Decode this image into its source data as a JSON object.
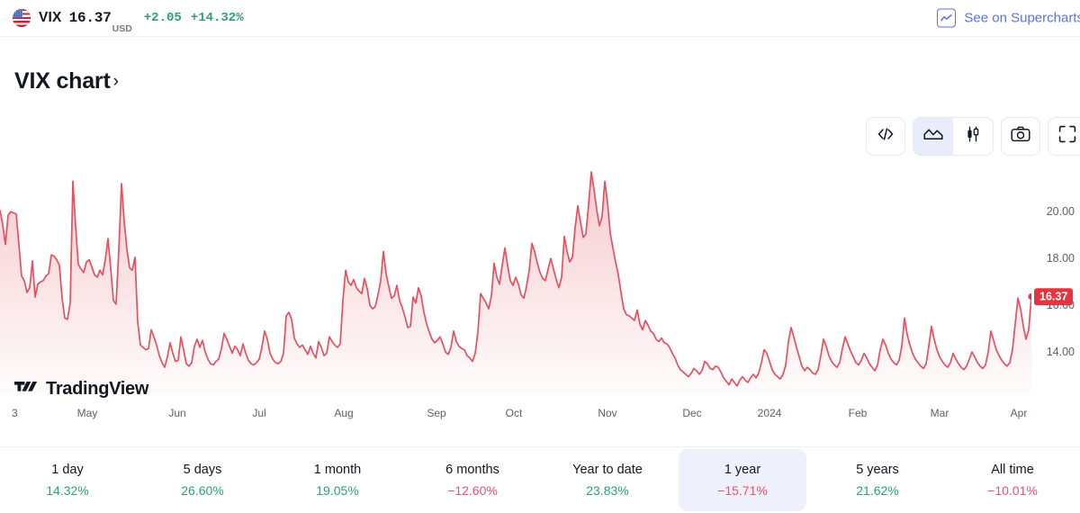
{
  "quote": {
    "flag_icon": "us-flag-icon",
    "ticker": "VIX",
    "price": "16.37",
    "currency": "USD",
    "change": "+2.05",
    "change_percent": "+14.32%",
    "change_color": "#2e9e7e",
    "supercharts_icon": "supercharts-wave-icon",
    "supercharts_label": "See on Supercharts",
    "supercharts_color": "#5a73d8"
  },
  "header": {
    "chart_title": "VIX chart",
    "chart_title_chevron": "›"
  },
  "toolbar": {
    "items": [
      {
        "name": "embed-code-button",
        "icon": "code-brackets-icon",
        "active": false
      },
      {
        "name": "area-chart-button",
        "icon": "area-chart-icon",
        "active": true
      },
      {
        "name": "candlestick-chart-button",
        "icon": "candlestick-icon",
        "active": false
      },
      {
        "name": "snapshot-button",
        "icon": "camera-icon",
        "active": false
      },
      {
        "name": "fullscreen-button",
        "icon": "fullscreen-icon",
        "active": false
      }
    ]
  },
  "watermark": {
    "logo_icon": "tradingview-logo-icon",
    "text": "TradingView"
  },
  "price_badge": {
    "value": "16.37",
    "background": "#e5333f",
    "text_color": "#ffffff"
  },
  "chart_data": {
    "type": "area",
    "title": "VIX chart",
    "xlabel": "",
    "ylabel": "",
    "line_color": "#e5515f",
    "fill_top_color": "rgba(229, 81, 95, 0.30)",
    "fill_bottom_color": "rgba(229, 81, 95, 0.02)",
    "grid": false,
    "legend": "none",
    "ylim": [
      12.2,
      22.2
    ],
    "yticks": [
      20.0,
      18.0,
      16.0,
      14.0
    ],
    "ytick_labels": [
      "20.00",
      "18.00",
      "16.00",
      "14.00"
    ],
    "xticks": [
      "3",
      "May",
      "Jun",
      "Jul",
      "Aug",
      "Sep",
      "Oct",
      "Nov",
      "Dec",
      "2024",
      "Feb",
      "Mar",
      "Apr"
    ],
    "xtick_positions": [
      16,
      97,
      197,
      288,
      382,
      485,
      571,
      675,
      769,
      855,
      953,
      1044,
      1132
    ],
    "last_value": 16.37,
    "values": [
      20.05,
      19.45,
      18.6,
      19.85,
      20.0,
      19.95,
      19.9,
      18.6,
      17.25,
      17.05,
      16.55,
      16.75,
      17.9,
      16.35,
      16.9,
      17.0,
      17.05,
      17.25,
      17.35,
      18.15,
      18.1,
      17.95,
      17.7,
      16.3,
      15.45,
      15.4,
      16.1,
      21.3,
      19.4,
      17.75,
      17.55,
      17.4,
      17.85,
      17.95,
      17.65,
      17.3,
      17.2,
      17.5,
      17.3,
      17.95,
      18.85,
      17.6,
      16.2,
      16.05,
      18.35,
      21.2,
      19.6,
      18.4,
      17.6,
      17.5,
      18.05,
      15.3,
      14.3,
      14.2,
      14.1,
      14.15,
      14.95,
      14.65,
      14.3,
      13.85,
      13.55,
      13.35,
      13.8,
      14.4,
      13.95,
      13.6,
      13.65,
      14.65,
      14.1,
      13.5,
      13.4,
      13.55,
      14.25,
      14.55,
      14.2,
      14.5,
      14.0,
      13.7,
      13.5,
      13.45,
      13.6,
      13.7,
      14.15,
      14.8,
      14.55,
      14.25,
      13.95,
      14.25,
      14.1,
      13.85,
      14.35,
      13.95,
      13.65,
      13.5,
      13.45,
      13.55,
      13.7,
      14.2,
      14.9,
      14.55,
      13.95,
      13.7,
      13.55,
      13.5,
      13.6,
      13.95,
      15.55,
      15.7,
      15.4,
      14.6,
      14.35,
      14.2,
      14.3,
      14.1,
      13.9,
      14.25,
      13.95,
      13.75,
      14.45,
      14.2,
      13.85,
      13.95,
      14.65,
      14.45,
      14.3,
      14.2,
      14.35,
      16.2,
      17.5,
      17.0,
      16.85,
      17.1,
      16.75,
      16.6,
      16.5,
      17.15,
      16.7,
      16.0,
      15.85,
      15.95,
      16.45,
      17.05,
      18.3,
      17.35,
      16.8,
      16.3,
      16.4,
      16.85,
      16.2,
      15.9,
      15.5,
      15.05,
      15.1,
      16.35,
      16.1,
      16.75,
      16.4,
      15.7,
      15.2,
      14.85,
      14.55,
      14.4,
      14.5,
      14.65,
      14.35,
      14.0,
      13.9,
      14.2,
      14.9,
      14.45,
      14.25,
      14.15,
      14.1,
      13.85,
      13.75,
      13.6,
      13.95,
      14.85,
      16.5,
      16.3,
      16.1,
      15.85,
      16.4,
      17.8,
      17.2,
      16.9,
      17.7,
      18.45,
      17.7,
      17.05,
      16.85,
      17.2,
      16.9,
      16.45,
      16.3,
      16.8,
      17.5,
      18.65,
      18.3,
      17.8,
      17.4,
      17.15,
      17.05,
      17.55,
      18.0,
      17.55,
      17.1,
      16.75,
      17.2,
      18.95,
      18.3,
      17.85,
      18.05,
      19.3,
      20.25,
      19.55,
      18.9,
      19.05,
      20.3,
      21.7,
      20.95,
      20.1,
      19.4,
      19.8,
      21.3,
      20.4,
      19.1,
      18.45,
      17.85,
      17.3,
      16.55,
      15.85,
      15.6,
      15.55,
      15.45,
      15.35,
      15.8,
      15.2,
      14.95,
      15.35,
      15.15,
      14.9,
      14.8,
      14.55,
      14.45,
      14.6,
      14.4,
      14.35,
      14.2,
      13.95,
      13.75,
      13.45,
      13.25,
      13.15,
      13.05,
      12.95,
      13.1,
      13.3,
      13.2,
      13.05,
      13.2,
      13.6,
      13.5,
      13.3,
      13.25,
      13.4,
      13.35,
      13.15,
      12.9,
      12.75,
      12.6,
      12.85,
      12.7,
      12.55,
      12.8,
      12.95,
      12.8,
      12.7,
      12.9,
      13.05,
      12.9,
      13.1,
      13.55,
      14.1,
      13.95,
      13.6,
      13.25,
      13.05,
      12.95,
      12.85,
      13.05,
      13.45,
      14.45,
      15.05,
      14.65,
      14.2,
      13.8,
      13.4,
      13.2,
      13.35,
      13.25,
      13.1,
      13.05,
      13.25,
      13.85,
      14.55,
      14.25,
      13.85,
      13.6,
      13.45,
      13.35,
      13.55,
      14.15,
      14.65,
      14.35,
      14.05,
      13.8,
      13.55,
      13.45,
      13.65,
      13.95,
      13.75,
      13.5,
      13.35,
      13.2,
      13.45,
      14.1,
      14.55,
      14.3,
      13.95,
      13.7,
      13.55,
      13.45,
      13.65,
      14.25,
      15.45,
      14.75,
      14.3,
      13.95,
      13.7,
      13.55,
      13.4,
      13.3,
      13.5,
      14.25,
      15.1,
      14.55,
      14.1,
      13.8,
      13.6,
      13.45,
      13.35,
      13.55,
      13.95,
      13.7,
      13.5,
      13.35,
      13.25,
      13.4,
      13.7,
      14.0,
      13.8,
      13.55,
      13.4,
      13.3,
      13.45,
      14.0,
      14.9,
      14.5,
      14.1,
      13.85,
      13.65,
      13.5,
      13.4,
      13.55,
      14.1,
      15.2,
      16.3,
      15.85,
      15.1,
      14.55,
      14.95,
      16.37
    ]
  },
  "performance": {
    "items": [
      {
        "label": "1 day",
        "value": "14.32%",
        "direction": "up",
        "active": false
      },
      {
        "label": "5 days",
        "value": "26.60%",
        "direction": "up",
        "active": false
      },
      {
        "label": "1 month",
        "value": "19.05%",
        "direction": "up",
        "active": false
      },
      {
        "label": "6 months",
        "value": "−12.60%",
        "direction": "down",
        "active": false
      },
      {
        "label": "Year to date",
        "value": "23.83%",
        "direction": "up",
        "active": false
      },
      {
        "label": "1 year",
        "value": "−15.71%",
        "direction": "down",
        "active": true
      },
      {
        "label": "5 years",
        "value": "21.62%",
        "direction": "up",
        "active": false
      },
      {
        "label": "All time",
        "value": "−10.01%",
        "direction": "down",
        "active": false
      }
    ]
  }
}
